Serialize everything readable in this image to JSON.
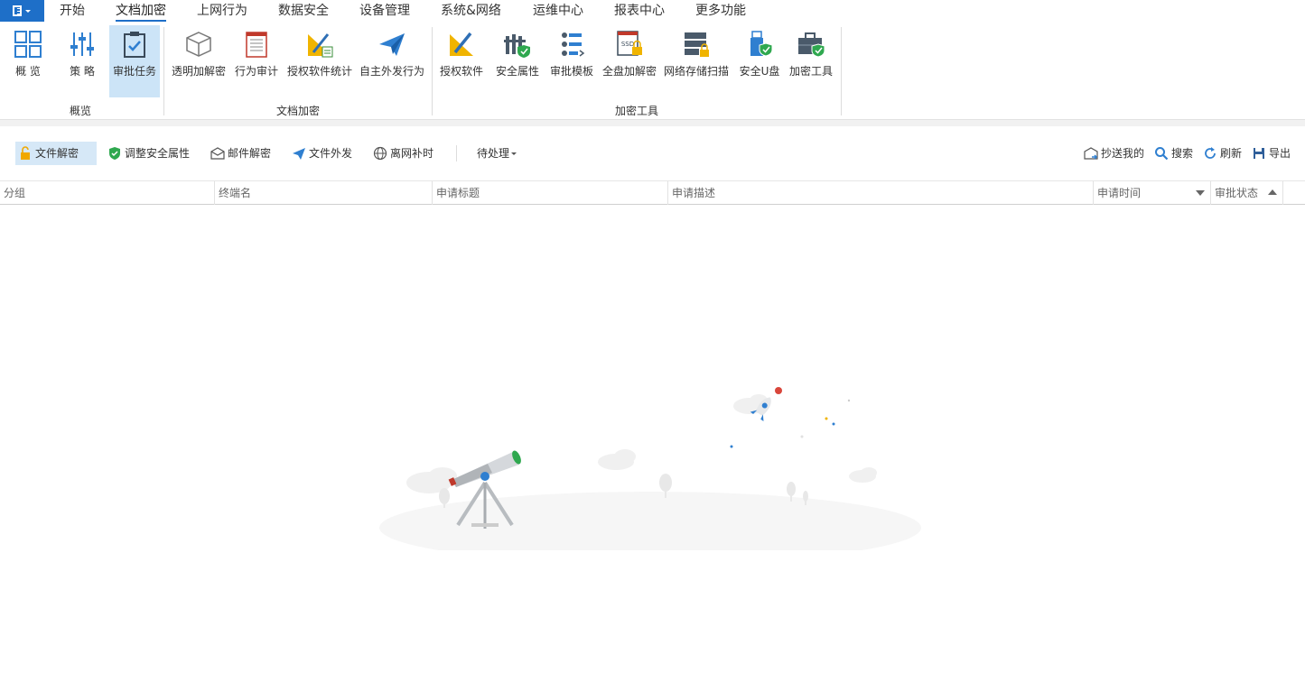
{
  "menubar": {
    "tabs": [
      "开始",
      "文档加密",
      "上网行为",
      "数据安全",
      "设备管理",
      "系统&网络",
      "运维中心",
      "报表中心",
      "更多功能"
    ],
    "active_index": 1
  },
  "ribbon": {
    "groups": [
      {
        "label": "概览",
        "items": [
          "概 览",
          "策 略",
          "审批任务"
        ]
      },
      {
        "label": "文档加密",
        "items": [
          "透明加解密",
          "行为审计",
          "授权软件统计",
          "自主外发行为"
        ]
      },
      {
        "label": "加密工具",
        "items": [
          "授权软件",
          "安全属性",
          "审批模板",
          "全盘加解密",
          "网络存储扫描",
          "安全U盘",
          "加密工具"
        ]
      }
    ],
    "selected_item": "审批任务"
  },
  "toolbar": {
    "left": [
      "文件解密",
      "调整安全属性",
      "邮件解密",
      "文件外发",
      "离网补时"
    ],
    "dropdown": "待处理",
    "right": [
      "抄送我的",
      "搜索",
      "刷新",
      "导出"
    ],
    "active": "文件解密"
  },
  "grid": {
    "columns": [
      "分组",
      "终端名",
      "申请标题",
      "申请描述",
      "申请时间",
      "审批状态"
    ]
  },
  "colors": {
    "accent": "#1e6fc8",
    "selected_bg": "#cce4f7"
  }
}
